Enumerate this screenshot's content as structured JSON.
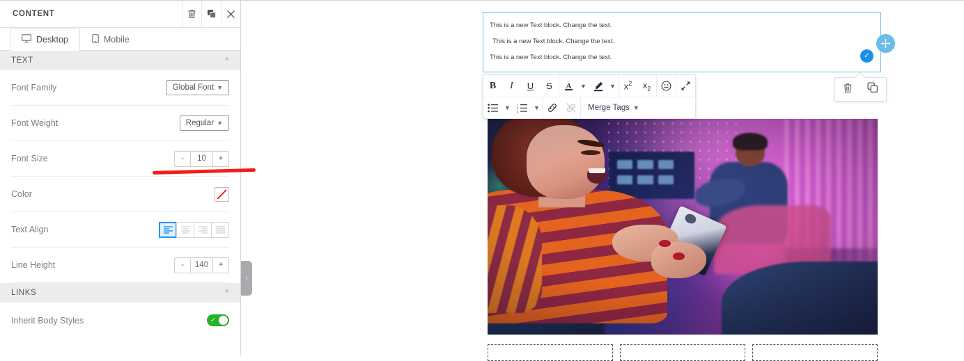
{
  "panel": {
    "title": "CONTENT",
    "header_actions": [
      {
        "name": "delete-icon",
        "label": "Delete"
      },
      {
        "name": "duplicate-icon",
        "label": "Duplicate"
      },
      {
        "name": "close-icon",
        "label": "Close"
      }
    ],
    "tabs": [
      {
        "id": "desktop",
        "label": "Desktop",
        "icon": "desktop-icon",
        "active": true
      },
      {
        "id": "mobile",
        "label": "Mobile",
        "icon": "mobile-icon",
        "active": false
      }
    ],
    "sections": [
      {
        "id": "text",
        "title": "TEXT",
        "collapsed": false,
        "rows": [
          {
            "id": "font-family",
            "label": "Font Family",
            "control": "dropdown",
            "value": "Global Font"
          },
          {
            "id": "font-weight",
            "label": "Font Weight",
            "control": "dropdown",
            "value": "Regular"
          },
          {
            "id": "font-size",
            "label": "Font Size",
            "control": "stepper",
            "value": "10",
            "minus": "-",
            "plus": "+"
          },
          {
            "id": "color",
            "label": "Color",
            "control": "swatch",
            "value": "#ff0000"
          },
          {
            "id": "text-align",
            "label": "Text Align",
            "control": "align",
            "value": "left"
          },
          {
            "id": "line-height",
            "label": "Line Height",
            "control": "stepper",
            "value": "140",
            "minus": "-",
            "plus": "+"
          }
        ]
      },
      {
        "id": "links",
        "title": "LINKS",
        "collapsed": false,
        "rows": [
          {
            "id": "inherit-body-styles",
            "label": "Inherit Body Styles",
            "control": "toggle",
            "value": "on"
          }
        ]
      }
    ],
    "collapse_handle": "‹"
  },
  "canvas": {
    "text_block": {
      "lines": [
        "This is a new Text block. Change the text.",
        "This is a new Text block. Change the text.",
        "This is a new Text block. Change the text."
      ]
    },
    "move_handle_label": "move-handle",
    "done_badge_label": "✓",
    "row_actions": [
      {
        "name": "delete-icon",
        "label": "Delete"
      },
      {
        "name": "duplicate-icon",
        "label": "Duplicate"
      }
    ],
    "toolbar": {
      "row1": [
        {
          "name": "bold-icon",
          "label": "B"
        },
        {
          "name": "italic-icon",
          "label": "I"
        },
        {
          "name": "underline-icon",
          "label": "U"
        },
        {
          "name": "strikethrough-icon",
          "label": "S"
        },
        {
          "name": "text-color-icon",
          "label": "A"
        },
        {
          "name": "highlight-color-icon",
          "label": "pen"
        },
        {
          "name": "superscript-icon",
          "label": "x²"
        },
        {
          "name": "subscript-icon",
          "label": "x₂"
        },
        {
          "name": "emoji-icon",
          "label": "☺"
        },
        {
          "name": "clear-formatting-icon",
          "label": "arrows"
        }
      ],
      "row2": [
        {
          "name": "bullet-list-icon",
          "label": "bullets"
        },
        {
          "name": "numbered-list-icon",
          "label": "numbers"
        },
        {
          "name": "link-icon",
          "label": "link"
        },
        {
          "name": "unlink-icon",
          "label": "unlink"
        },
        {
          "name": "merge-tags-dropdown",
          "label": "Merge Tags"
        }
      ],
      "merge_tags_label": "Merge Tags"
    },
    "placeholders": [
      {
        "id": "placeholder-1"
      },
      {
        "id": "placeholder-2"
      },
      {
        "id": "placeholder-3"
      }
    ]
  },
  "annotation": {
    "name": "red-underline",
    "color": "#f41c1c"
  },
  "colors": {
    "accent_blue": "#2196f3",
    "toggle_green": "#24b324",
    "move_handle_blue": "#69bde8",
    "section_header_bg": "#ececec",
    "annotation_red": "#f41c1c"
  }
}
